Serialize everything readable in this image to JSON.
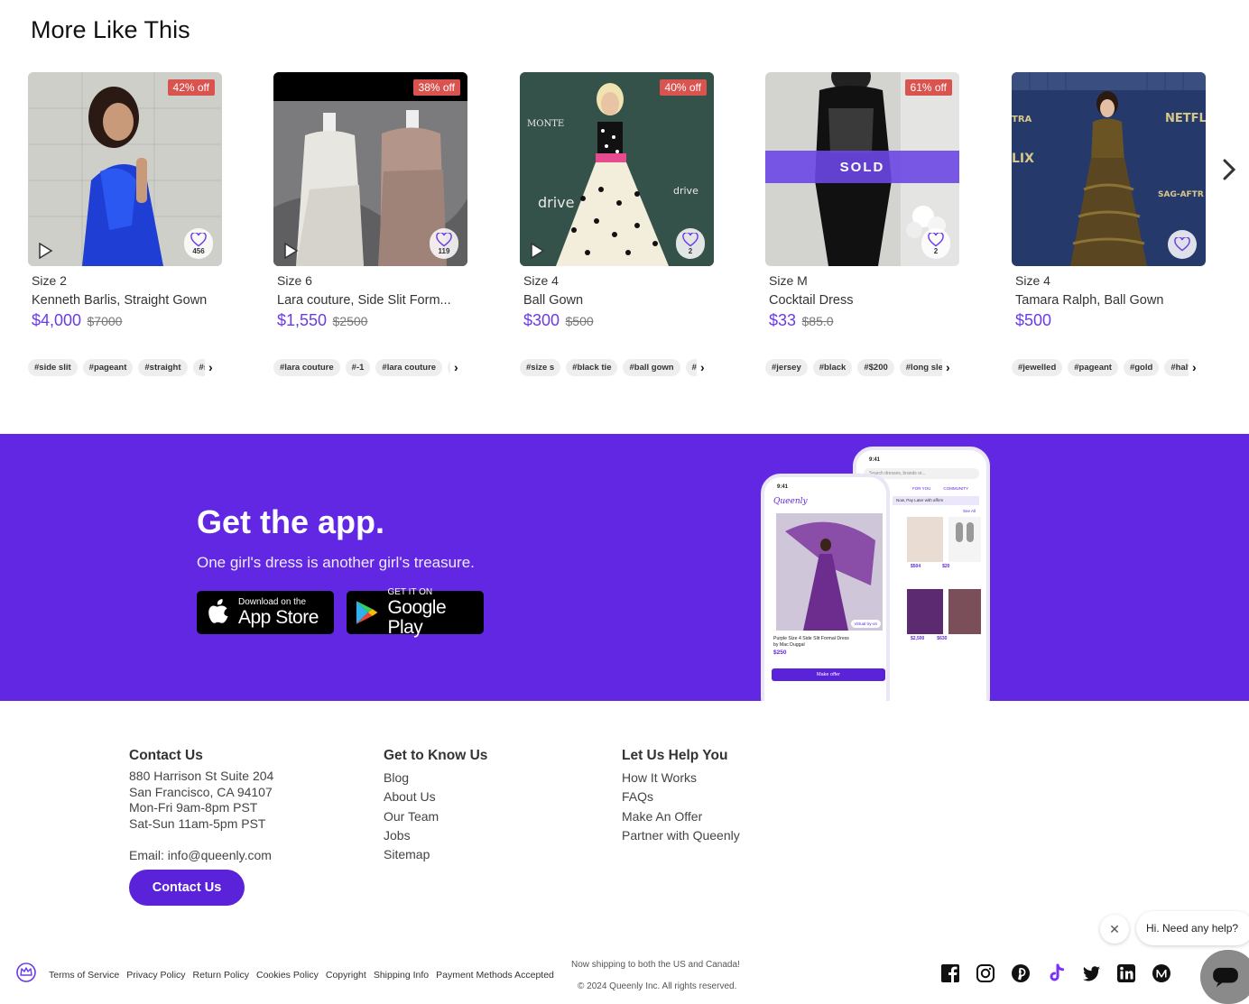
{
  "more_like_this": {
    "title": "More Like This",
    "cards": [
      {
        "discount": "42% off",
        "likes": "456",
        "size": "Size 2",
        "name": "Kenneth Barlis, Straight Gown",
        "price": "$4,000",
        "original": "$7000",
        "sold": "",
        "has_video": true,
        "tags": [
          "#side slit",
          "#pageant",
          "#straight",
          "#s"
        ]
      },
      {
        "discount": "38% off",
        "likes": "119",
        "size": "Size 6",
        "name": "Lara couture, Side Slit Form...",
        "price": "$1,550",
        "original": "$2500",
        "sold": "",
        "has_video": true,
        "tags": [
          "#lara couture",
          "#-1",
          "#lara couture",
          "#"
        ]
      },
      {
        "discount": "40% off",
        "likes": "2",
        "size": "Size 4",
        "name": "Ball Gown",
        "price": "$300",
        "original": "$500",
        "sold": "",
        "has_video": true,
        "tags": [
          "#size s",
          "#black tie",
          "#ball gown",
          "#bl"
        ]
      },
      {
        "discount": "61% off",
        "likes": "2",
        "size": "Size M",
        "name": "Cocktail Dress",
        "price": "$33",
        "original": "$85.0",
        "sold": "SOLD",
        "has_video": false,
        "tags": [
          "#jersey",
          "#black",
          "#$200",
          "#long slee"
        ]
      },
      {
        "discount": "",
        "likes": "",
        "size": "Size 4",
        "name": "Tamara Ralph, Ball Gown",
        "price": "$500",
        "original": "",
        "sold": "",
        "has_video": false,
        "tags": [
          "#jewelled",
          "#pageant",
          "#gold",
          "#halte"
        ]
      }
    ]
  },
  "app_promo": {
    "title": "Get the app.",
    "subtitle": "One girl's dress is another girl's treasure.",
    "app_store": {
      "small": "Download on the",
      "big": "App Store"
    },
    "google_play": {
      "small": "GET IT ON",
      "big": "Google Play"
    },
    "phone_front": {
      "time": "9:41",
      "brand": "Queenly",
      "product_title": "Purple Size 4 Side Slit Formal Dress by Mac Duggal",
      "price": "$250",
      "virtual_try_on": "Virtual try-on",
      "make_offer": "Make offer"
    },
    "phone_back": {
      "time": "9:41",
      "search": "Search dresses, brands or...",
      "tabs": [
        "FOR YOU",
        "COMMUNITY"
      ],
      "affirm": "Now, Pay Later with affirm",
      "see_all": "See All",
      "prices": [
        "$504",
        "$20",
        "$2,500",
        "$630"
      ]
    }
  },
  "footer": {
    "contact": {
      "heading": "Contact Us",
      "address1": "880 Harrison St Suite 204",
      "address2": "San Francisco, CA 94107",
      "hours1": "Mon-Fri 9am-8pm PST",
      "hours2": "Sat-Sun 11am-5pm PST",
      "email": "Email: info@queenly.com",
      "button": "Contact Us"
    },
    "know_us": {
      "heading": "Get to Know Us",
      "links": [
        "Blog",
        "About Us",
        "Our Team",
        "Jobs",
        "Sitemap"
      ]
    },
    "help": {
      "heading": "Let Us Help You",
      "links": [
        "How It Works",
        "FAQs",
        "Make An Offer",
        "Partner with Queenly"
      ]
    },
    "legal_links": [
      "Terms of Service",
      "Privacy Policy",
      "Return Policy",
      "Cookies Policy",
      "Copyright",
      "Shipping Info",
      "Payment Methods Accepted"
    ],
    "shipping_note": "Now shipping to both the US and Canada!",
    "copyright": "© 2024 Queenly Inc. All rights reserved.",
    "socials": [
      "facebook-icon",
      "instagram-icon",
      "pinterest-icon",
      "tiktok-icon",
      "twitter-icon",
      "linkedin-icon",
      "medium-icon"
    ]
  },
  "chat": {
    "greeting": "Hi. Need any help?"
  },
  "colors": {
    "brand_purple": "#6227e3",
    "price_purple": "#6b3be8",
    "discount_red": "#d9534f"
  }
}
